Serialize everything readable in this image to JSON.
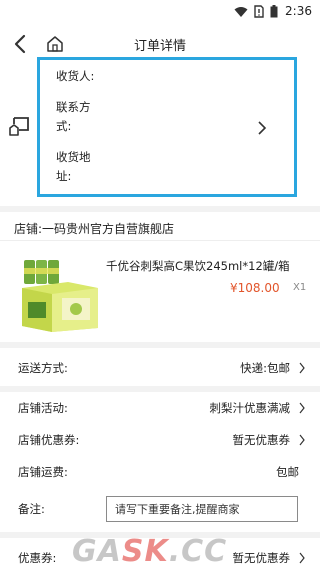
{
  "status_bar": {
    "time": "2:36"
  },
  "nav": {
    "title": "订单详情"
  },
  "address": {
    "name_label": "收货人:",
    "phone_label": "联系方式:",
    "address_label": "收货地址:"
  },
  "shop": {
    "name": "店铺:一码贵州官方自营旗舰店"
  },
  "product": {
    "title": "千优谷刺梨高C果饮245ml*12罐/箱",
    "price": "¥108.00",
    "quantity": "X1"
  },
  "rows": [
    {
      "label": "运送方式:",
      "value": "快递:包邮"
    },
    {
      "label": "店铺活动:",
      "value": "刺梨汁优惠满减"
    },
    {
      "label": "店铺优惠券:",
      "value": "暂无优惠券"
    },
    {
      "label": "店铺运费:",
      "value": "包邮"
    }
  ],
  "remark": {
    "label": "备注:",
    "placeholder": "请写下重要备注,提醒商家"
  },
  "coupon": {
    "label": "优惠券:",
    "value": "暂无优惠券"
  },
  "watermark": {
    "part1": "GA",
    "part2": "SK",
    "part3": ".CC"
  },
  "colors": {
    "accent_border": "#2aa6df",
    "price": "#e2552b",
    "background": "#ffffff"
  }
}
